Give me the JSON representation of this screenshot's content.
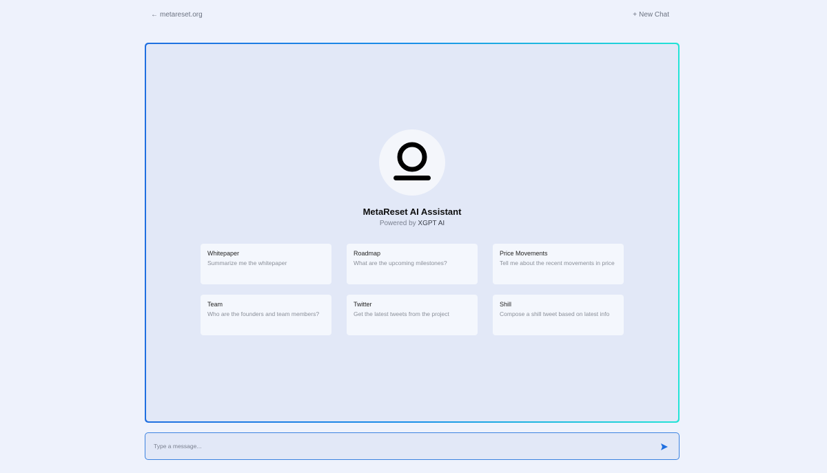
{
  "header": {
    "back_arrow": "←",
    "back_label": "metareset.org",
    "new_chat_plus": "+",
    "new_chat_label": "New Chat"
  },
  "assistant": {
    "title": "MetaReset AI Assistant",
    "powered_prefix": "Powered by",
    "powered_brand": "XGPT AI",
    "avatar_icon": "metareset-logo-icon"
  },
  "suggestions": [
    {
      "title": "Whitepaper",
      "desc": "Summarize me the whitepaper"
    },
    {
      "title": "Roadmap",
      "desc": "What are the upcoming milestones?"
    },
    {
      "title": "Price Movements",
      "desc": "Tell me about the recent movements in price"
    },
    {
      "title": "Team",
      "desc": "Who are the founders and team members?"
    },
    {
      "title": "Twitter",
      "desc": "Get the latest tweets from the project"
    },
    {
      "title": "Shill",
      "desc": "Compose a shill tweet based on latest info"
    }
  ],
  "composer": {
    "placeholder": "Type a message...",
    "value": "",
    "send_icon": "send-icon"
  },
  "colors": {
    "accent": "#1f6fe0",
    "accent_end": "#22e3d6",
    "background": "#eef2fc",
    "panel": "#e2e8f7"
  }
}
